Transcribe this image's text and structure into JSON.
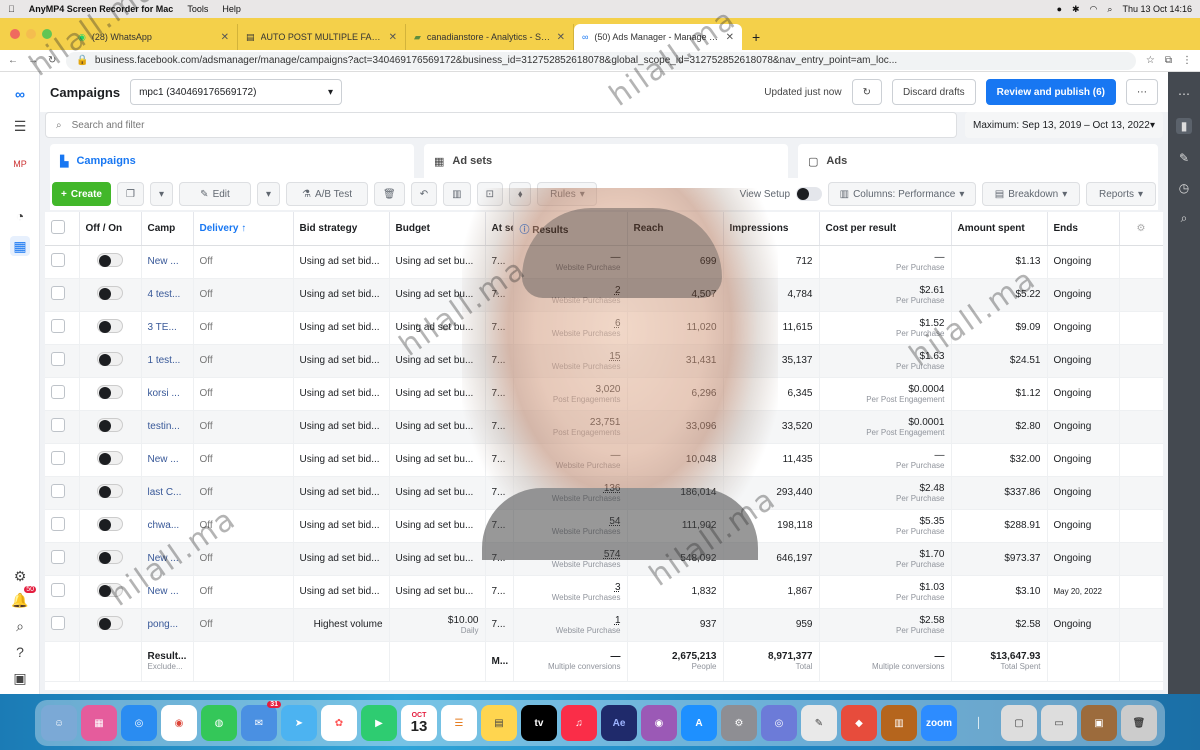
{
  "menubar": {
    "apple": "",
    "app": "AnyMP4 Screen Recorder for Mac",
    "items": [
      "Tools",
      "Help"
    ],
    "datetime": "Thu 13 Oct  14:16"
  },
  "browser": {
    "tabs": [
      {
        "title": "(28) WhatsApp",
        "icon": "whatsapp-icon"
      },
      {
        "title": "AUTO POST MULTIPLE FACEBOOK",
        "icon": "document-icon"
      },
      {
        "title": "canadianstore - Analytics - Shopify",
        "icon": "shopify-icon"
      },
      {
        "title": "(50) Ads Manager - Manage ads",
        "icon": "meta-icon",
        "active": true
      }
    ],
    "url": "business.facebook.com/adsmanager/manage/campaigns?act=340469176569172&business_id=312752852618078&global_scope_id=312752852618078&nav_entry_point=am_loc..."
  },
  "header": {
    "title": "Campaigns",
    "account": "mpc1 (340469176569172)",
    "updated": "Updated just now",
    "discard": "Discard drafts",
    "publish": "Review and publish (6)"
  },
  "search": {
    "placeholder": "Search and filter",
    "date_range": "Maximum: Sep 13, 2019 – Oct 13, 2022"
  },
  "levels": {
    "campaigns": "Campaigns",
    "adsets": "Ad sets",
    "ads": "Ads"
  },
  "toolbar": {
    "create": "Create",
    "edit": "Edit",
    "ab_test": "A/B Test",
    "rules": "Rules",
    "view_setup": "View Setup",
    "columns": "Columns: Performance",
    "breakdown": "Breakdown",
    "reports": "Reports"
  },
  "table": {
    "headers": {
      "offon": "Off / On",
      "camp": "Camp",
      "delivery": "Delivery ↑",
      "bid": "Bid strategy",
      "budget": "Budget",
      "att": "At sett",
      "results": "Results",
      "reach": "Reach",
      "impressions": "Impressions",
      "cpr": "Cost per result",
      "spent": "Amount spent",
      "ends": "Ends"
    },
    "rows": [
      {
        "name": "New ...",
        "delivery": "Off",
        "bid": "Using ad set bid...",
        "budget": "Using ad set bu...",
        "att": "7...",
        "results": "—",
        "results_sub": "Website Purchase",
        "reach": "699",
        "impr": "712",
        "cpr": "—",
        "cpr_sub": "Per Purchase",
        "spent": "$1.13",
        "ends": "Ongoing"
      },
      {
        "name": "4 test...",
        "delivery": "Off",
        "bid": "Using ad set bid...",
        "budget": "Using ad set bu...",
        "att": "7...",
        "results": "2",
        "results_sub": "Website Purchases",
        "reach": "4,507",
        "impr": "4,784",
        "cpr": "$2.61",
        "cpr_sub": "Per Purchase",
        "spent": "$5.22",
        "ends": "Ongoing"
      },
      {
        "name": "3 TE...",
        "delivery": "Off",
        "bid": "Using ad set bid...",
        "budget": "Using ad set bu...",
        "att": "7...",
        "results": "6",
        "results_sub": "Website Purchases",
        "reach": "11,020",
        "impr": "11,615",
        "cpr": "$1.52",
        "cpr_sub": "Per Purchase",
        "spent": "$9.09",
        "ends": "Ongoing"
      },
      {
        "name": "1 test...",
        "delivery": "Off",
        "bid": "Using ad set bid...",
        "budget": "Using ad set bu...",
        "att": "7...",
        "results": "15",
        "results_sub": "Website Purchases",
        "reach": "31,431",
        "impr": "35,137",
        "cpr": "$1.63",
        "cpr_sub": "Per Purchase",
        "spent": "$24.51",
        "ends": "Ongoing"
      },
      {
        "name": "korsi ...",
        "delivery": "Off",
        "bid": "Using ad set bid...",
        "budget": "Using ad set bu...",
        "att": "7...",
        "results": "3,020",
        "results_sub": "Post Engagements",
        "reach": "6,296",
        "impr": "6,345",
        "cpr": "$0.0004",
        "cpr_sub": "Per Post Engagement",
        "spent": "$1.12",
        "ends": "Ongoing"
      },
      {
        "name": "testin...",
        "delivery": "Off",
        "bid": "Using ad set bid...",
        "budget": "Using ad set bu...",
        "att": "7...",
        "results": "23,751",
        "results_sub": "Post Engagements",
        "reach": "33,096",
        "impr": "33,520",
        "cpr": "$0.0001",
        "cpr_sub": "Per Post Engagement",
        "spent": "$2.80",
        "ends": "Ongoing"
      },
      {
        "name": "New ...",
        "delivery": "Off",
        "bid": "Using ad set bid...",
        "budget": "Using ad set bu...",
        "att": "7...",
        "results": "—",
        "results_sub": "Website Purchase",
        "reach": "10,048",
        "impr": "11,435",
        "cpr": "—",
        "cpr_sub": "Per Purchase",
        "spent": "$32.00",
        "ends": "Ongoing"
      },
      {
        "name": "last C...",
        "delivery": "Off",
        "bid": "Using ad set bid...",
        "budget": "Using ad set bu...",
        "att": "7...",
        "results": "136",
        "results_sub": "Website Purchases",
        "reach": "186,014",
        "impr": "293,440",
        "cpr": "$2.48",
        "cpr_sub": "Per Purchase",
        "spent": "$337.86",
        "ends": "Ongoing"
      },
      {
        "name": "chwa...",
        "delivery": "Off",
        "bid": "Using ad set bid...",
        "budget": "Using ad set bu...",
        "att": "7...",
        "results": "54",
        "results_sub": "Website Purchases",
        "reach": "111,902",
        "impr": "198,118",
        "cpr": "$5.35",
        "cpr_sub": "Per Purchase",
        "spent": "$288.91",
        "ends": "Ongoing"
      },
      {
        "name": "New ...",
        "delivery": "Off",
        "bid": "Using ad set bid...",
        "budget": "Using ad set bu...",
        "att": "7...",
        "results": "574",
        "results_sub": "Website Purchases",
        "reach": "548,092",
        "impr": "646,197",
        "cpr": "$1.70",
        "cpr_sub": "Per Purchase",
        "spent": "$973.37",
        "ends": "Ongoing"
      },
      {
        "name": "New ...",
        "delivery": "Off",
        "bid": "Using ad set bid...",
        "budget": "Using ad set bu...",
        "att": "7...",
        "results": "3",
        "results_sub": "Website Purchases",
        "reach": "1,832",
        "impr": "1,867",
        "cpr": "$1.03",
        "cpr_sub": "Per Purchase",
        "spent": "$3.10",
        "ends": "May 20, 2022"
      },
      {
        "name": "pong...",
        "delivery": "Off",
        "bid": "Highest volume",
        "budget": "$10.00",
        "budget_sub": "Daily",
        "att": "7...",
        "results": "1",
        "results_sub": "Website Purchase",
        "reach": "937",
        "impr": "959",
        "cpr": "$2.58",
        "cpr_sub": "Per Purchase",
        "spent": "$2.58",
        "ends": "Ongoing"
      }
    ],
    "footer": {
      "name": "Result...",
      "name_sub": "Exclude...",
      "att": "M...",
      "results": "—",
      "results_sub": "Multiple conversions",
      "reach": "2,675,213",
      "reach_sub": "People",
      "impr": "8,971,377",
      "impr_sub": "Total",
      "cpr": "—",
      "cpr_sub": "Multiple conversions",
      "spent": "$13,647.93",
      "spent_sub": "Total Spent"
    }
  },
  "watermark": "hilall.ma",
  "dock": {
    "calendar_month": "OCT",
    "calendar_day": "13",
    "mail_badge": "31",
    "notif_badge": "50",
    "tv": "tv",
    "ae": "Ae",
    "zoom": "zoom"
  },
  "colors": {
    "accent": "#1877f2",
    "create": "#42b72a",
    "tabbar": "#f4d04a",
    "link": "#385898"
  }
}
